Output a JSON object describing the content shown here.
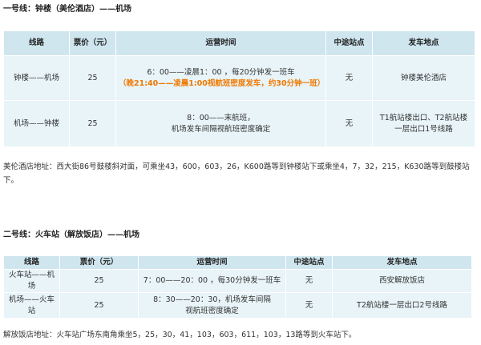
{
  "sections": [
    {
      "title": "一号线：钟楼（美伦酒店）——机场",
      "headers": [
        "线路",
        "票价（元）",
        "运营时间",
        "中途站点",
        "发车地点"
      ],
      "rows": [
        {
          "route": "钟楼——机场",
          "fare": "25",
          "hours": [
            "6：00——凌晨1：00 ，每20分钟发一班车"
          ],
          "hours_highlight": "（晚21:40——凌晨1:00视航班密度发车，约30分钟一班）",
          "stops": "无",
          "depart": [
            "钟楼美伦酒店"
          ]
        },
        {
          "route": "机场——钟楼",
          "fare": "25",
          "hours": [
            "8：00——末航班，",
            "机场发车间隔视航班密度确定"
          ],
          "stops": "无",
          "depart": [
            "T1航站楼出口、T2航站楼",
            "一层出口1号线路"
          ]
        }
      ],
      "address": "美伦酒店地址：西大街86号鼓楼斜对面，可乘坐43，600，603，26，K600路等到钟楼站下或乘坐4，7，32，215，K630路等到鼓楼站下。"
    },
    {
      "title": "二号线：火车站（解放饭店）——机场",
      "headers": [
        "线路",
        "票价（元）",
        "运营时间",
        "中途站点",
        "发车地点"
      ],
      "rows": [
        {
          "route": "火车站——机场",
          "fare": "25",
          "hours": [
            "7：00——20：00 ，每30分钟发一班车"
          ],
          "stops": "无",
          "depart": [
            "西安解放饭店"
          ]
        },
        {
          "route": "机场——火车站",
          "fare": "25",
          "hours": [
            "8：30——20：30，机场发车间隔",
            "视航班密度确定"
          ],
          "stops": "无",
          "depart": [
            "T2航站楼一层出口2号线路"
          ]
        }
      ],
      "address": "解放饭店地址：火车站广场东南角乘坐5，25，30，41，103，603，611，103，13路等到火车站下。"
    }
  ],
  "colors": {
    "header_bg": "#cfe6ef",
    "cell_bg": "#e8f4f8",
    "highlight": "#f07800",
    "border": "#ffffff"
  }
}
